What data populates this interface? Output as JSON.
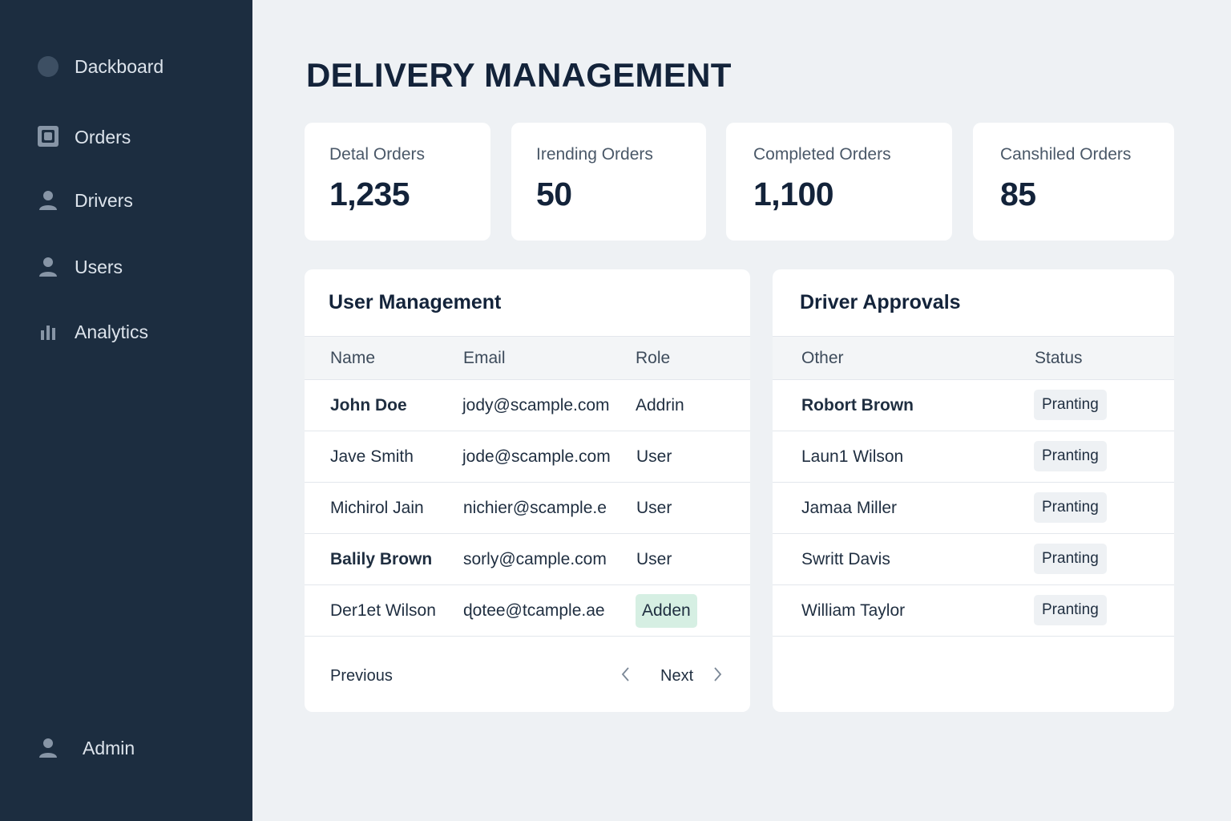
{
  "sidebar": {
    "items": [
      {
        "label": "Dackboard",
        "icon": "dashboard-icon"
      },
      {
        "label": "Orders",
        "icon": "orders-icon"
      },
      {
        "label": "Drivers",
        "icon": "person-icon"
      },
      {
        "label": "Users",
        "icon": "person-icon"
      },
      {
        "label": "Analytics",
        "icon": "bar-chart-icon"
      }
    ],
    "admin": {
      "label": "Admin",
      "icon": "person-icon"
    }
  },
  "page": {
    "title": "DELIVERY MANAGEMENT"
  },
  "stats": [
    {
      "label": "Detal Orders",
      "value": "1,235"
    },
    {
      "label": "Irending Orders",
      "value": "50"
    },
    {
      "label": "Completed Orders",
      "value": "1,100"
    },
    {
      "label": "Canshiled Orders",
      "value": "85"
    }
  ],
  "user_management": {
    "title": "User Management",
    "columns": [
      "Name",
      "Email",
      "Role"
    ],
    "rows": [
      {
        "name": "John Doe",
        "email": "jody@scample.com",
        "role": "Addrin"
      },
      {
        "name": "Jave Smith",
        "email": "jode@scample.com",
        "role": "User"
      },
      {
        "name": "Michirol Jain",
        "email": "nichier@scample.e",
        "role": "User"
      },
      {
        "name": "Balily Brown",
        "email": "sorly@camplе.com",
        "role": "User"
      },
      {
        "name": "Der1et Wilson",
        "email": "ɖotee@tcample.ae",
        "role": "Adden"
      }
    ],
    "pagination": {
      "previous": "Previous",
      "next": "Next"
    }
  },
  "driver_approvals": {
    "title": "Driver Approvals",
    "columns": [
      "Other",
      "Status"
    ],
    "rows": [
      {
        "name": "Robort Brown",
        "status": "Pranting"
      },
      {
        "name": "Laun1 Wilson",
        "status": "Pranting"
      },
      {
        "name": "Jamaa Miller",
        "status": "Pranting"
      },
      {
        "name": "Swritt Davis",
        "status": "Pranting"
      },
      {
        "name": "William Taylor",
        "status": "Pranting"
      }
    ]
  },
  "colors": {
    "sidebar_bg": "#1c2d40",
    "page_bg": "#eef1f4",
    "role_badge_bg": "#d6efe3",
    "status_badge_bg": "#eef1f4"
  }
}
